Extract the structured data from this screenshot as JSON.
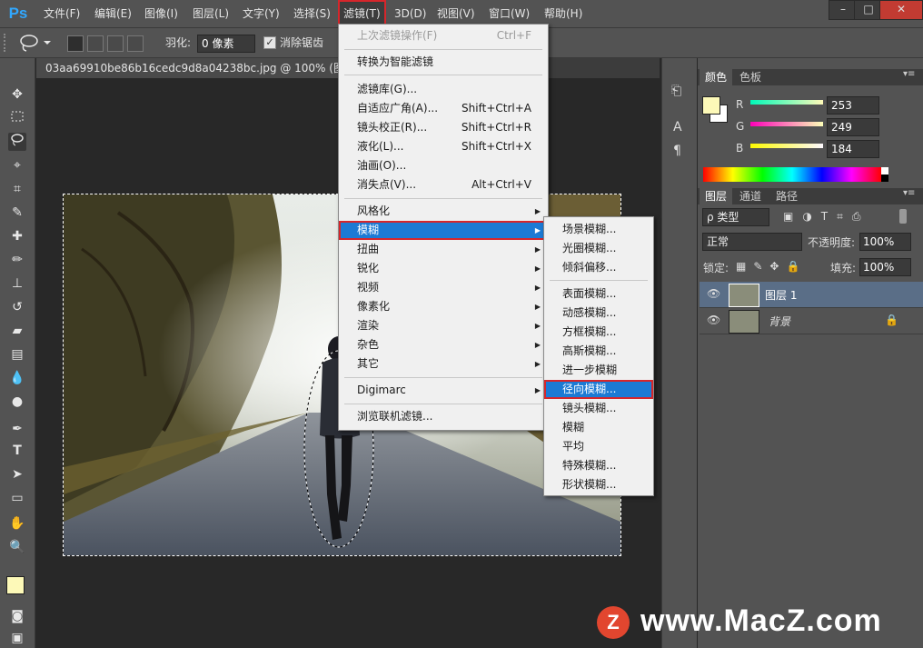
{
  "app": {
    "logo": "Ps"
  },
  "menubar": {
    "items": [
      "文件(F)",
      "编辑(E)",
      "图像(I)",
      "图层(L)",
      "文字(Y)",
      "选择(S)",
      "滤镜(T)",
      "3D(D)",
      "视图(V)",
      "窗口(W)",
      "帮助(H)"
    ],
    "active": "滤镜(T)",
    "window_buttons": [
      "–",
      "□",
      "✕"
    ]
  },
  "options": {
    "feather_label": "羽化:",
    "feather_value": "0 像素",
    "antialias_label": "消除锯齿",
    "antialias_checked": true
  },
  "document": {
    "tab_title": "03aa69910be86b16cedc9d8a04238bc.jpg @ 100% (图层 1,"
  },
  "filter_menu": {
    "items": [
      {
        "label": "上次滤镜操作(F)",
        "shortcut": "Ctrl+F",
        "disabled": true
      },
      {
        "sep": true
      },
      {
        "label": "转换为智能滤镜"
      },
      {
        "sep": true
      },
      {
        "label": "滤镜库(G)..."
      },
      {
        "label": "自适应广角(A)...",
        "shortcut": "Shift+Ctrl+A"
      },
      {
        "label": "镜头校正(R)...",
        "shortcut": "Shift+Ctrl+R"
      },
      {
        "label": "液化(L)...",
        "shortcut": "Shift+Ctrl+X"
      },
      {
        "label": "油画(O)..."
      },
      {
        "label": "消失点(V)...",
        "shortcut": "Alt+Ctrl+V"
      },
      {
        "sep": true
      },
      {
        "label": "风格化",
        "submenu": true
      },
      {
        "label": "模糊",
        "submenu": true,
        "highlighted": true
      },
      {
        "label": "扭曲",
        "submenu": true
      },
      {
        "label": "锐化",
        "submenu": true
      },
      {
        "label": "视频",
        "submenu": true
      },
      {
        "label": "像素化",
        "submenu": true
      },
      {
        "label": "渲染",
        "submenu": true
      },
      {
        "label": "杂色",
        "submenu": true
      },
      {
        "label": "其它",
        "submenu": true
      },
      {
        "sep": true
      },
      {
        "label": "Digimarc",
        "submenu": true
      },
      {
        "sep": true
      },
      {
        "label": "浏览联机滤镜..."
      }
    ]
  },
  "blur_submenu": {
    "items": [
      {
        "label": "场景模糊..."
      },
      {
        "label": "光圈模糊..."
      },
      {
        "label": "倾斜偏移..."
      },
      {
        "sep": true
      },
      {
        "label": "表面模糊..."
      },
      {
        "label": "动感模糊..."
      },
      {
        "label": "方框模糊..."
      },
      {
        "label": "高斯模糊..."
      },
      {
        "label": "进一步模糊"
      },
      {
        "label": "径向模糊...",
        "highlighted": true
      },
      {
        "label": "镜头模糊..."
      },
      {
        "label": "模糊"
      },
      {
        "label": "平均"
      },
      {
        "label": "特殊模糊..."
      },
      {
        "label": "形状模糊..."
      }
    ]
  },
  "color_panel": {
    "tabs": [
      "颜色",
      "色板"
    ],
    "r_label": "R",
    "g_label": "G",
    "b_label": "B",
    "r": "253",
    "g": "249",
    "b": "184",
    "foreground": "#fdf9b8"
  },
  "layers_panel": {
    "tabs": [
      "图层",
      "通道",
      "路径"
    ],
    "filter_label": "ρ 类型",
    "blend_mode": "正常",
    "opacity_label": "不透明度:",
    "opacity_value": "100%",
    "lock_label": "锁定:",
    "fill_label": "填充:",
    "fill_value": "100%",
    "layers": [
      {
        "name": "图层 1",
        "selected": true
      },
      {
        "name": "背景",
        "locked": true
      }
    ]
  },
  "watermark": {
    "logo": "Z",
    "text": "www.MacZ.com"
  }
}
